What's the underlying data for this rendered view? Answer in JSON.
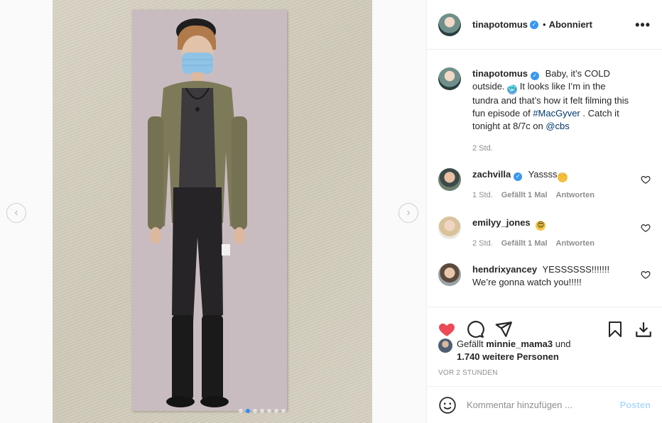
{
  "post": {
    "author": "tinapotomus",
    "follow_separator": "•",
    "follow_state": "Abonniert",
    "more_label": "•••",
    "verified_mark": "✓",
    "carousel_dots": 7,
    "carousel_active": 1,
    "prev_label": "‹",
    "next_label": "›"
  },
  "caption": {
    "user": "tinapotomus",
    "text_1": "Baby, it’s COLD outside. ",
    "emoji": "🥶",
    "text_2": " It looks like I’m in the tundra and that’s how it felt filming this fun episode of ",
    "hashtag": "#MacGyver",
    "text_3": ". Catch it tonight at 8/7c on ",
    "mention": "@cbs",
    "time": "2 Std."
  },
  "comments": [
    {
      "user": "zachvilla",
      "verified": true,
      "text": "Yassss",
      "emoji": "🙌",
      "time": "1 Std.",
      "likes": "Gefällt 1 Mal",
      "reply": "Antworten"
    },
    {
      "user": "emilyy_jones",
      "verified": false,
      "text": "",
      "emoji": "😍",
      "time": "2 Std.",
      "likes": "Gefällt 1 Mal",
      "reply": "Antworten"
    },
    {
      "user": "hendrixyancey",
      "verified": false,
      "text": "YESSSSSS!!!!!!! We’re gonna watch you!!!!!",
      "emoji": "",
      "time": "",
      "likes": "",
      "reply": ""
    }
  ],
  "likes": {
    "prefix": "Gefällt",
    "user": "minnie_mama3",
    "mid": "und",
    "count": "1.740 weitere Personen"
  },
  "timestamp": "VOR 2 STUNDEN",
  "add_comment": {
    "placeholder": "Kommentar hinzufügen ...",
    "post_label": "Posten"
  },
  "colors": {
    "like_red": "#ed4956",
    "link_blue": "#00376b",
    "verified_blue": "#3897f0",
    "post_disabled": "#b3dbff"
  },
  "icons": [
    "heart-icon",
    "comment-icon",
    "share-icon",
    "bookmark-icon",
    "download-icon",
    "smiley-icon",
    "verified-icon",
    "more-icon"
  ]
}
